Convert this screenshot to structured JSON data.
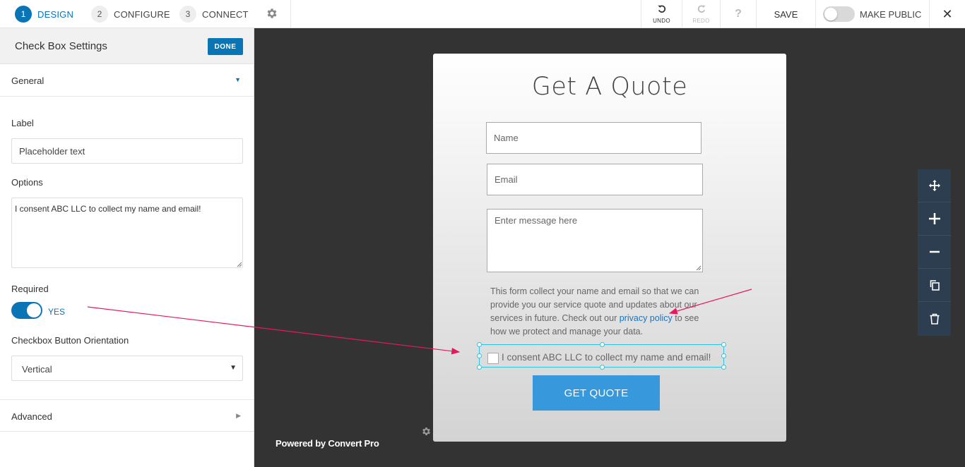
{
  "topbar": {
    "steps": [
      {
        "num": "1",
        "label": "DESIGN"
      },
      {
        "num": "2",
        "label": "CONFIGURE"
      },
      {
        "num": "3",
        "label": "CONNECT"
      }
    ],
    "undo_label": "UNDO",
    "redo_label": "REDO",
    "help_label": "?",
    "save_label": "SAVE",
    "make_public_label": "MAKE PUBLIC",
    "close_label": "✕"
  },
  "sidebar": {
    "title": "Check Box Settings",
    "done_label": "DONE",
    "general_label": "General",
    "label_label": "Label",
    "label_value": "Placeholder text",
    "options_label": "Options",
    "options_value": "I consent ABC LLC to collect my name and email!",
    "required_label": "Required",
    "required_state": "YES",
    "orientation_label": "Checkbox Button Orientation",
    "orientation_value": "Vertical",
    "advanced_label": "Advanced"
  },
  "form": {
    "title": "Get A Quote",
    "name_placeholder": "Name",
    "email_placeholder": "Email",
    "message_placeholder": "Enter message here",
    "disclaimer_before": "This form collect your name and email so that we can provide you our service quote and updates about our services in future. Check out our ",
    "disclaimer_link": "privacy policy",
    "disclaimer_after": " to see how we protect and manage your data.",
    "checkbox_label": "I consent ABC LLC to collect my name and email!",
    "submit_label": "GET QUOTE"
  },
  "footer": {
    "powered_by": "Powered by Convert Pro"
  },
  "colors": {
    "accent": "#0a75b5",
    "button": "#3898dc",
    "selection": "#2cc3e0",
    "annotation_arrow": "#e8185d",
    "canvas_bg": "#333333",
    "tools_bg": "#2c3e50"
  },
  "icons": {
    "settings": "gear-icon",
    "undo": "undo-icon",
    "redo": "redo-icon",
    "move": "move-icon",
    "zoom_in": "plus-icon",
    "zoom_out": "minus-icon",
    "duplicate": "copy-icon",
    "delete": "trash-icon"
  }
}
